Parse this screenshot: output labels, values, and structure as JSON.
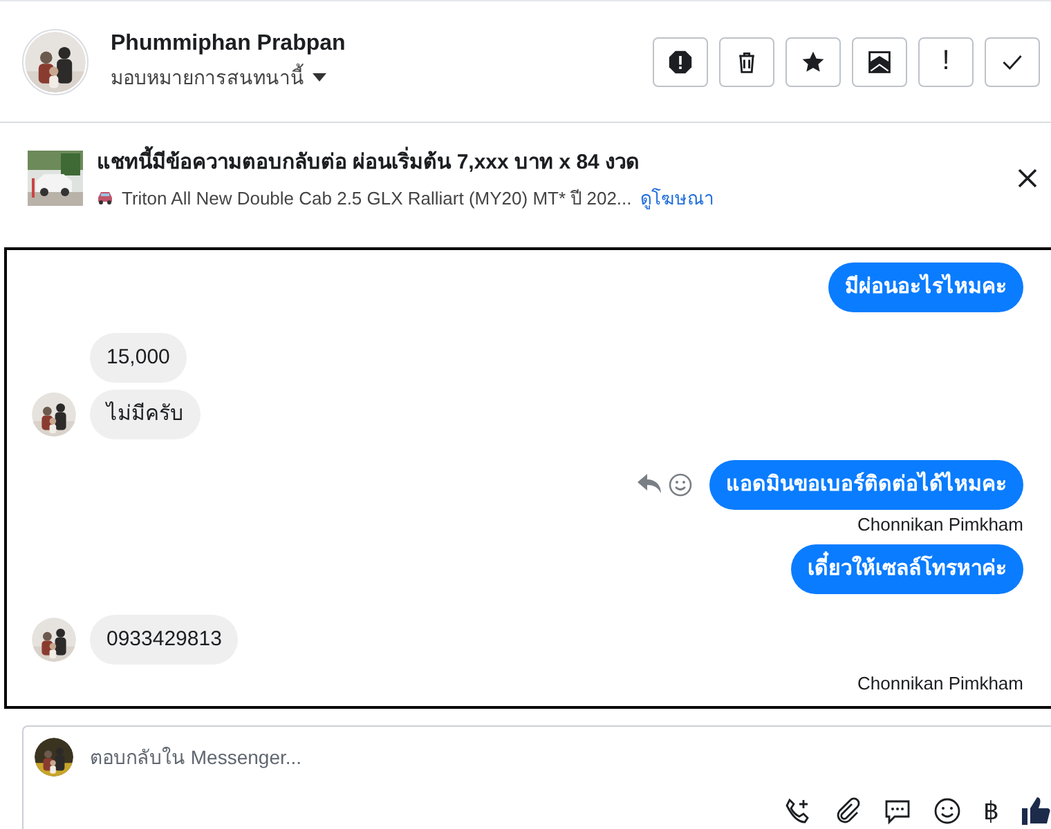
{
  "contact": {
    "name": "Phummiphan Prabpan",
    "assign_label": "มอบหมายการสนทนานี้"
  },
  "important_label": "!",
  "ad": {
    "title": "แชทนี้มีข้อความตอบกลับต่อ ผ่อนเริ่มต้น 7,xxx บาท x 84 งวด",
    "subtitle": "Triton All New Double Cab 2.5 GLX Ralliart (MY20) MT* ปี 202...",
    "link": "ดูโฆษณา"
  },
  "messages": [
    {
      "kind": "outgoing",
      "text": "มีผ่อนอะไรไหมคะ"
    },
    {
      "kind": "incoming",
      "text": "15,000",
      "avatar": false
    },
    {
      "kind": "incoming",
      "text": "ไม่มีครับ",
      "avatar": true
    },
    {
      "kind": "outgoing",
      "text": "แอดมินขอเบอร์ติดต่อได้ไหมคะ",
      "hover_actions": true,
      "sender": "Chonnikan Pimkham"
    },
    {
      "kind": "outgoing",
      "text": "เดี๋ยวให้เซลล์โทรหาค่ะ"
    },
    {
      "kind": "incoming",
      "text": "0933429813",
      "avatar": true
    },
    {
      "kind": "label",
      "text": "Chonnikan Pimkham"
    }
  ],
  "composer": {
    "placeholder": "ตอบกลับใน Messenger...",
    "currency_symbol": "฿"
  }
}
